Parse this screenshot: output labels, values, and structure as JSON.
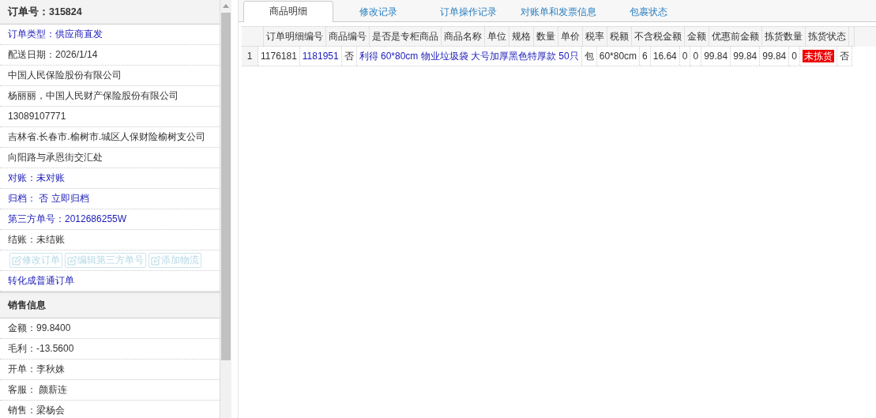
{
  "order_panel": {
    "title": "订单号：315824",
    "items": [
      {
        "kind": "highlight",
        "text": "订单类型：供应商直发"
      },
      {
        "kind": "text",
        "text": "配送日期：2026/1/14"
      },
      {
        "kind": "text",
        "text": "中国人民保险股份有限公司"
      },
      {
        "kind": "text",
        "text": "杨丽丽，中国人民财产保险股份有限公司"
      },
      {
        "kind": "text",
        "text": "13089107771"
      },
      {
        "kind": "text",
        "text": "吉林省.长春市.榆树市.城区人保财险榆树支公司"
      },
      {
        "kind": "text",
        "text": "向阳路与承恩街交汇处"
      },
      {
        "kind": "highlight",
        "text": "对账：未对账"
      },
      {
        "kind": "highlight",
        "text": "归档： 否 立即归档"
      },
      {
        "kind": "highlight",
        "text": "第三方单号：2012686255W"
      },
      {
        "kind": "text",
        "text": "结账：未结账"
      },
      {
        "kind": "actions",
        "buttons": [
          {
            "label": "修改订单",
            "disabled": true
          },
          {
            "label": "编辑第三方单号",
            "disabled": true
          },
          {
            "label": "添加物流",
            "disabled": true
          }
        ]
      },
      {
        "kind": "link",
        "text": "转化成普通订单"
      },
      {
        "kind": "section",
        "text": "销售信息"
      },
      {
        "kind": "text",
        "text": "金额：99.8400"
      },
      {
        "kind": "text",
        "text": "毛利：-13.5600"
      },
      {
        "kind": "text",
        "text": "开单：李秋姝"
      },
      {
        "kind": "text",
        "text": "客服： 颜薪连"
      },
      {
        "kind": "text",
        "text": "销售：梁杨会"
      }
    ]
  },
  "tabs": [
    {
      "label": "商品明细",
      "selected": true
    },
    {
      "label": "修改记录",
      "selected": false
    },
    {
      "label": "订单操作记录",
      "selected": false
    },
    {
      "label": "对账单和发票信息",
      "selected": false
    },
    {
      "label": "包裹状态",
      "selected": false
    }
  ],
  "detail_list": {
    "heading_strip": [
      "订单明细编号",
      "商品编号",
      "是否是专柜商品",
      "商品名称",
      "单位",
      "规格",
      "数量",
      "单价",
      "税率",
      "税额",
      "不含税金额",
      "金额",
      "优惠前金额",
      "拣货数量",
      "拣货状态"
    ],
    "record_lines": [
      {
        "index": "1",
        "values": [
          {
            "kind": "text",
            "text": "1176181"
          },
          {
            "kind": "link",
            "text": "1181951"
          },
          {
            "kind": "text",
            "text": "否"
          },
          {
            "kind": "link",
            "text": "利得 60*80cm 物业垃圾袋 大号加厚黑色特厚款 50只"
          },
          {
            "kind": "text",
            "text": "包"
          },
          {
            "kind": "text",
            "text": "60*80cm"
          },
          {
            "kind": "text",
            "text": "6"
          },
          {
            "kind": "text",
            "text": "16.64"
          },
          {
            "kind": "text",
            "text": "0"
          },
          {
            "kind": "text",
            "text": "0"
          },
          {
            "kind": "text",
            "text": "99.84"
          },
          {
            "kind": "text",
            "text": "99.84"
          },
          {
            "kind": "text",
            "text": "99.84"
          },
          {
            "kind": "text",
            "text": "0"
          },
          {
            "kind": "alert",
            "text": "未拣货"
          },
          {
            "kind": "text",
            "text": "否"
          }
        ]
      }
    ]
  }
}
